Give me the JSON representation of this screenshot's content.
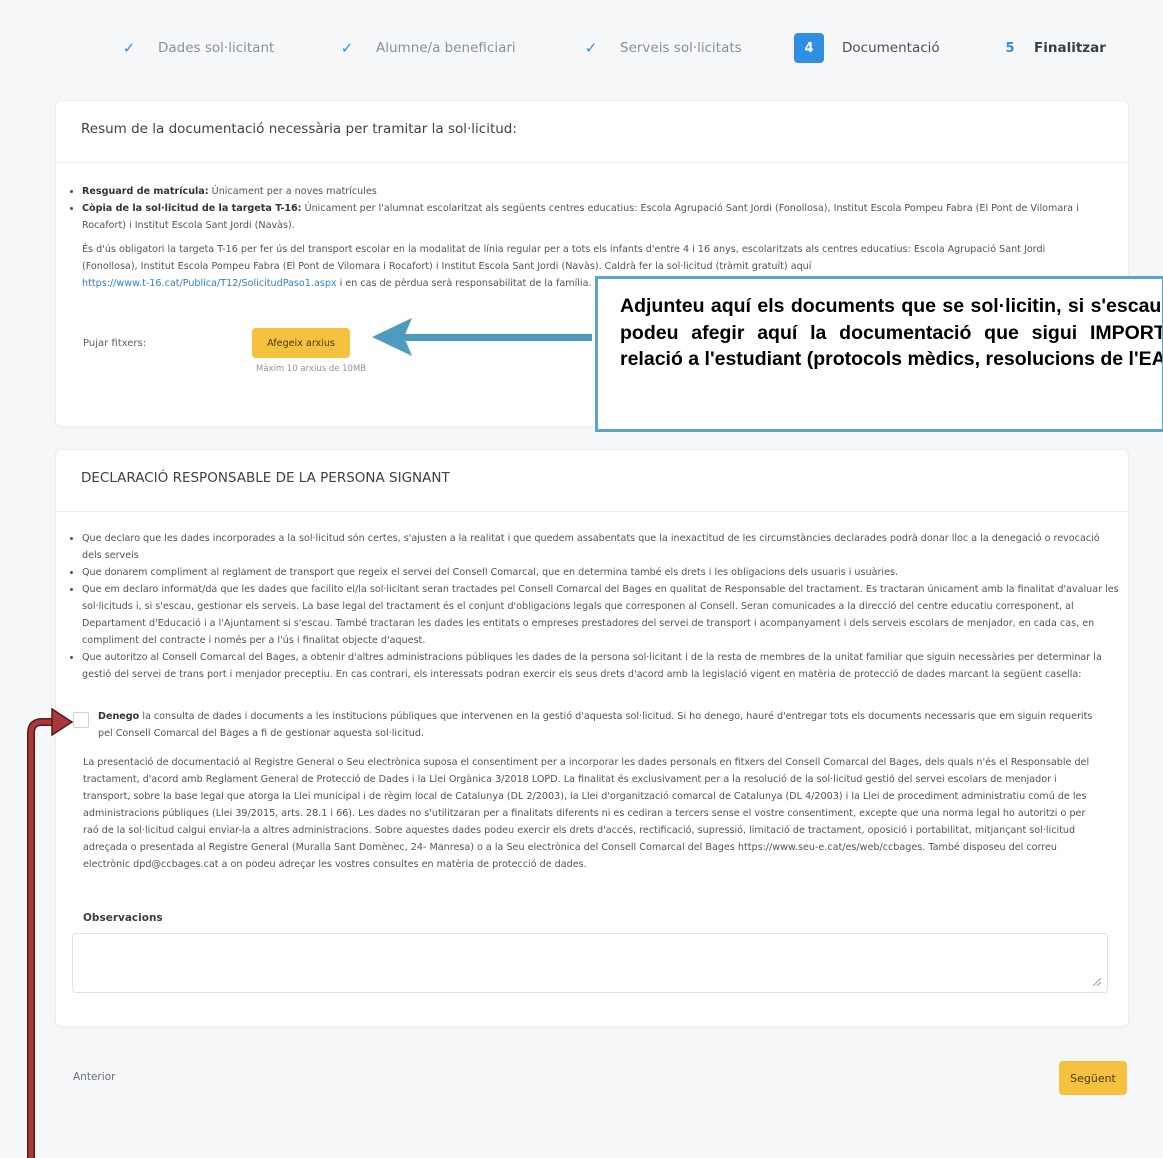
{
  "stepper": {
    "steps": [
      {
        "label": "Dades sol·licitant"
      },
      {
        "label": "Alumne/a beneficiari"
      },
      {
        "label": "Serveis sol·licitats"
      },
      {
        "number": "4",
        "label": "Documentació"
      },
      {
        "number": "5",
        "label": "Finalitzar"
      }
    ]
  },
  "documentation": {
    "title": "Resum de la documentació necessària per tramitar la sol·licitud:",
    "items": [
      {
        "bold": "Resguard de matrícula:",
        "text": " Únicament per a noves matrícules"
      },
      {
        "bold": "Còpia de la sol·licitud de la targeta T-16:",
        "text": " Únicament per l'alumnat escolaritzat als següents centres educatius: Escola Agrupació Sant Jordi (Fonollosa), Institut Escola Pompeu Fabra (El Pont de Vilomara i Rocafort) i Institut Escola Sant Jordi (Navàs)."
      }
    ],
    "paragraph": "És d'ús obligatori la targeta T-16 per fer ús del transport escolar en la modalitat de línia regular per a tots els infants d'entre 4 i 16 anys, escolaritzats als centres educatius: Escola Agrupació Sant Jordi (Fonollosa), Institut Escola Pompeu Fabra (El Pont de Vilomara i Rocafort) i Institut Escola Sant Jordi (Navàs). Caldrà fer la sol·licitud (tràmit gratuït) aquí",
    "link": "https://www.t-16.cat/Publica/T12/SolicitudPaso1.aspx",
    "paragraph_end": " i en cas de pèrdua serà responsabilitat de la família.",
    "upload_label": "Pujar fitxers:",
    "add_files": "Afegeix arxius",
    "max_hint": "Màxim 10 arxius de 10MB"
  },
  "callout": {
    "text": "Adjunteu aquí els documents que se sol·licitin, si s'escau. També, podeu afegir aquí la documentació que sigui IMPORTANT en relació a l'estudiant (protocols mèdics, resolucions de l'EAP, etc)."
  },
  "declaration": {
    "title": "DECLARACIÓ RESPONSABLE DE LA PERSONA SIGNANT",
    "items": [
      "Que declaro que les dades incorporades a la sol·licitud són certes, s'ajusten a la realitat i que quedem assabentats que la inexactitud de les circumstàncies declarades podrà donar lloc a la denegació o revocació dels serveis",
      "Que donarem compliment al reglament de transport que regeix el servei del Consell Comarcal, que en determina també els drets i les obligacions dels usuaris i usuàries.",
      "Que em declaro informat/da que les dades que facilito el/la sol·licitant seran tractades pel Consell Comarcal del Bages en qualitat de Responsable del tractament. Es tractaran únicament amb la finalitat d'avaluar les sol·licituds i, si s'escau, gestionar els serveis. La base legal del tractament és el conjunt d'obligacions legals que corresponen al Consell. Seran comunicades a la direcció del centre educatiu corresponent, al Departament d'Educació i a l'Ajuntament si s'escau. També tractaran les dades les entitats o empreses prestadores del servei de transport i acompanyament i dels serveis escolars de menjador, en cada cas, en compliment del contracte i només per a l'ús i finalitat objecte d'aquest.",
      "Que autoritzo al Consell Comarcal del Bages, a obtenir d'altres administracions públiques les dades de la persona sol·licitant i de la resta de membres de la unitat familiar que siguin necessàries per determinar la gestió del servei de trans port i menjador preceptiu. En cas contrari, els interessats podran exercir els seus drets d'acord amb la legislació vigent en matèria de protecció de dades marcant la següent casella:"
    ],
    "deny_bold": "Denego",
    "deny_text": " la consulta de dades i documents a les institucions públiques que intervenen en la gestió d'aquesta sol·licitud. Si ho denego, hauré d'entregar tots els documents necessaris que em siguin requerits pel Consell Comarcal del Bages a fi de gestionar aquesta sol·licitud.",
    "privacy": "La presentació de documentació al Registre General o Seu electrònica suposa el consentiment per a incorporar les dades personals en fitxers del Consell Comarcal del Bages, dels quals n'és el Responsable del tractament, d'acord amb Reglament General de Protecció de Dades i la Llei Orgànica 3/2018 LOPD. La finalitat és exclusivament per a la resolució de la sol·licitud gestió del servei escolars de menjador i transport, sobre la base legal que atorga la Llei municipal i de règim local de Catalunya (DL 2/2003), la Llei d'organització comarcal de Catalunya (DL 4/2003) i la Llei de procediment administratiu comú de les administracions públiques (Llei 39/2015, arts. 28.1 i 66). Les dades no s'utilitzaran per a finalitats diferents ni es cediran a tercers sense el vostre consentiment, excepte que una norma legal ho autoritzi o per raó de la sol·licitud calgui enviar-la a altres administracions. Sobre aquestes dades podeu exercir els drets d'accés, rectificació, supressió, limitació de tractament, oposició i portabilitat, mitjançant sol·licitud adreçada o presentada al Registre General (Muralla Sant Domènec, 24- Manresa) o a la Seu electrònica del Consell Comarcal del Bages https://www.seu-e.cat/es/web/ccbages. També disposeu del correu electrònic dpd@ccbages.cat a on podeu adreçar les vostres consultes en matèria de protecció de dades.",
    "observations_label": "Observacions"
  },
  "footer": {
    "previous": "Anterior",
    "next": "Següent"
  },
  "colors": {
    "accent": "#2f8fe0",
    "button": "#f4c23f",
    "callout_border": "#5aa6c6",
    "callout_arrow": "#4e9bbd",
    "annotation_arrow": "#9b2f2f"
  }
}
